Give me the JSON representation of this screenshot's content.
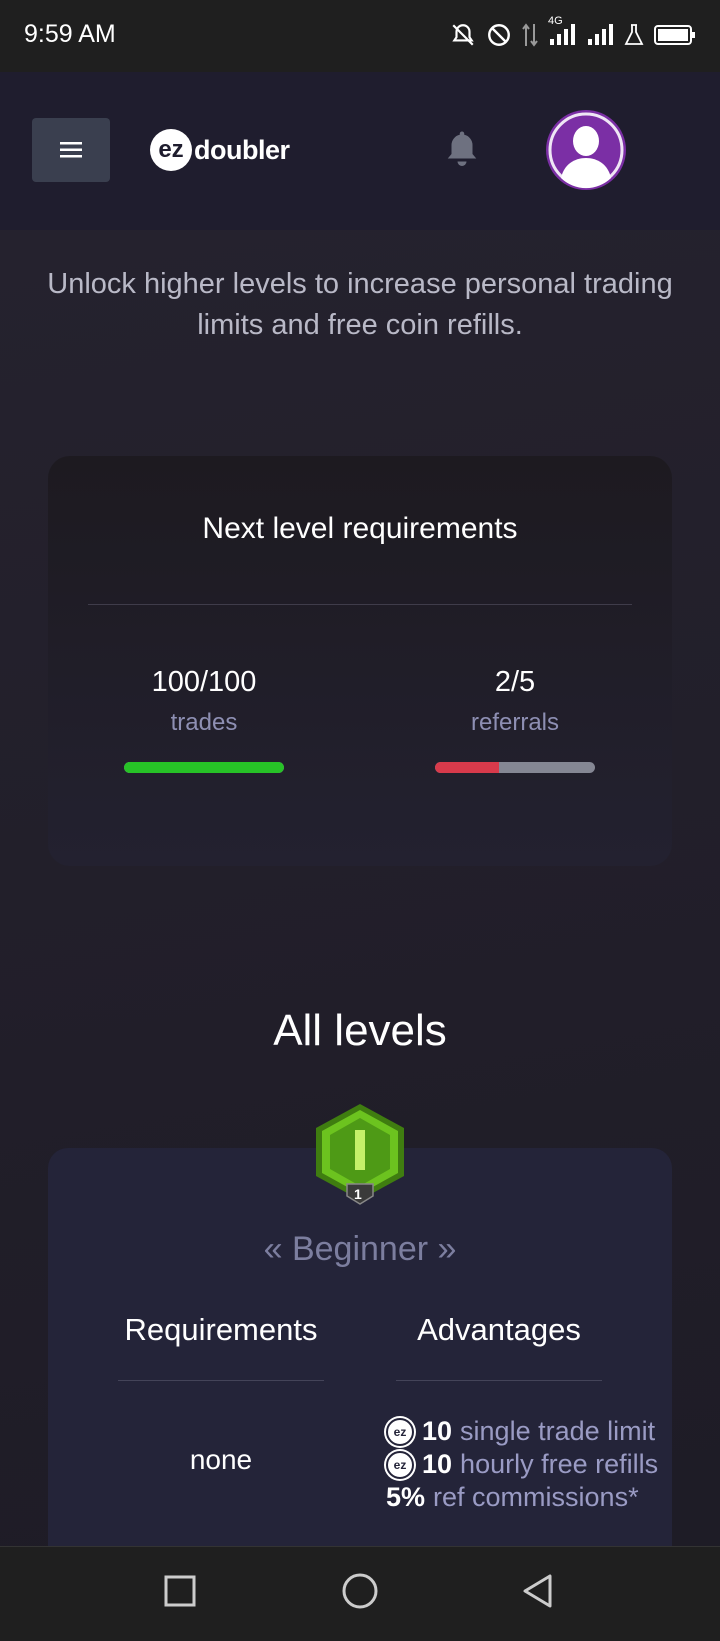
{
  "status_bar": {
    "time": "9:59 AM",
    "network": "4G",
    "icons": [
      "bell-off-icon",
      "do-not-disturb-icon",
      "data-arrows-icon",
      "signal-icon",
      "signal-icon",
      "flask-icon",
      "battery-icon"
    ]
  },
  "header": {
    "logo_badge": "ez",
    "logo_text": "doubler",
    "menu_icon": "hamburger-icon",
    "bell_icon": "bell-icon",
    "avatar_color": "#7b2fa5"
  },
  "intro_text": "Unlock higher levels to increase personal trading limits and free coin refills.",
  "requirements": {
    "title": "Next level requirements",
    "stats": [
      {
        "value": "100/100",
        "label": "trades",
        "progress": 1.0,
        "color": "#27c227"
      },
      {
        "value": "2/5",
        "label": "referrals",
        "progress": 0.4,
        "color": "#d83a4b"
      }
    ]
  },
  "levels_section": {
    "title": "All levels",
    "level": {
      "badge_number": "1",
      "name": "« Beginner »",
      "req_header": "Requirements",
      "adv_header": "Advantages",
      "requirement": "none",
      "advantages": [
        {
          "icon": "ez-coin-icon",
          "value": "10",
          "text": "single trade limit"
        },
        {
          "icon": "ez-coin-icon",
          "value": "10",
          "text": "hourly free refills"
        },
        {
          "icon": "",
          "value": "5%",
          "text": "ref commissions*"
        }
      ],
      "badge_color": "#5bb21a"
    }
  },
  "nav": {
    "buttons": [
      "recent-apps-icon",
      "home-icon",
      "back-icon"
    ]
  }
}
